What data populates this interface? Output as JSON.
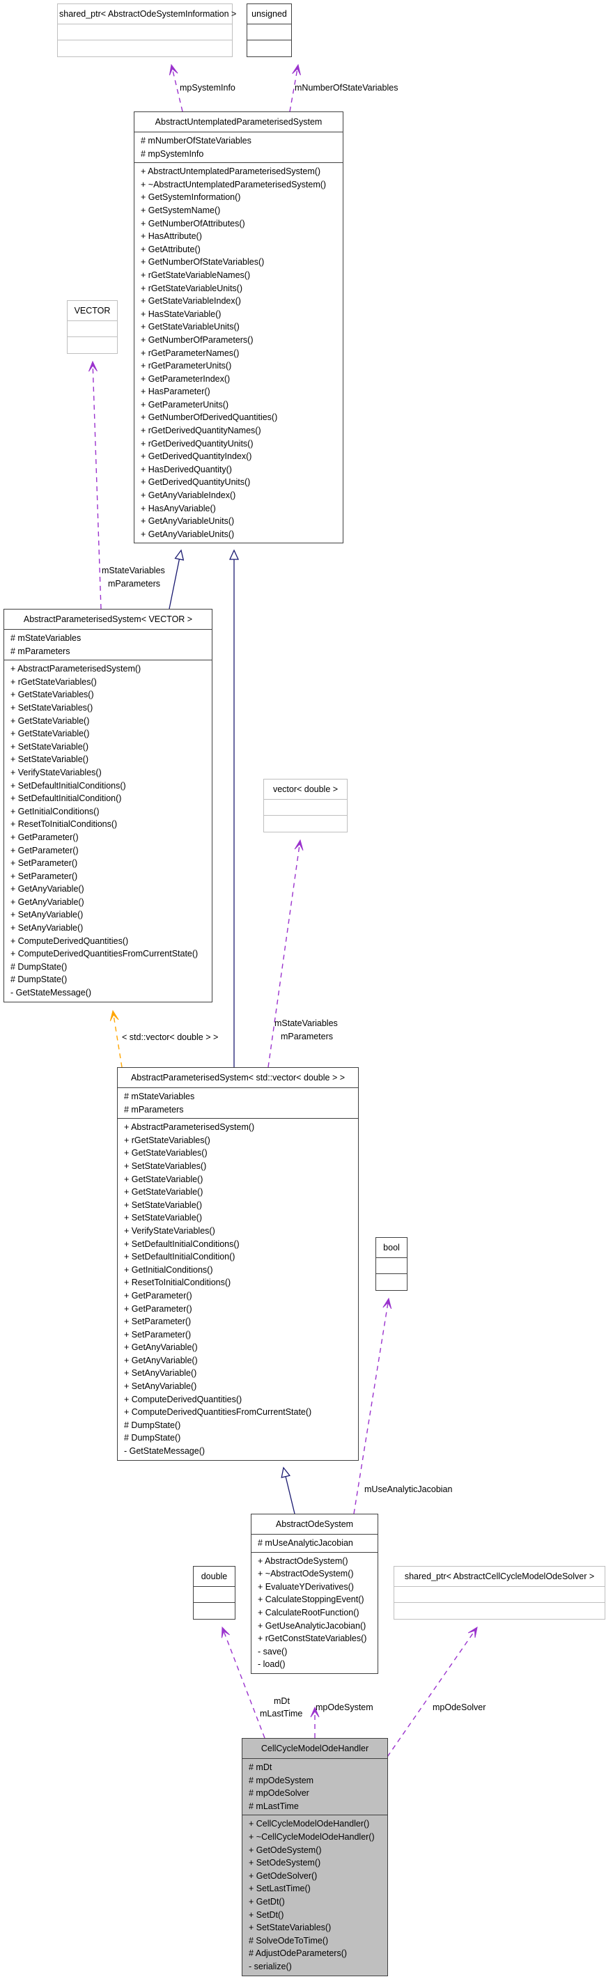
{
  "colors": {
    "usage_edge": "#9a32cd",
    "inherit_edge": "#191970",
    "template_edge": "#ffa500",
    "focus_fill": "#bfbfbf"
  },
  "classes": {
    "shared_ptr_info": {
      "title": "shared_ptr< AbstractOdeSystemInformation >",
      "attributes": [],
      "methods": []
    },
    "unsigned": {
      "title": "unsigned",
      "attributes": [],
      "methods": []
    },
    "untemplated": {
      "title": "AbstractUntemplatedParameterisedSystem",
      "attributes": [
        "# mNumberOfStateVariables",
        "# mpSystemInfo"
      ],
      "methods": [
        "+ AbstractUntemplatedParameterisedSystem()",
        "+ ~AbstractUntemplatedParameterisedSystem()",
        "+ GetSystemInformation()",
        "+ GetSystemName()",
        "+ GetNumberOfAttributes()",
        "+ HasAttribute()",
        "+ GetAttribute()",
        "+ GetNumberOfStateVariables()",
        "+ rGetStateVariableNames()",
        "+ rGetStateVariableUnits()",
        "+ GetStateVariableIndex()",
        "+ HasStateVariable()",
        "+ GetStateVariableUnits()",
        "+ GetNumberOfParameters()",
        "+ rGetParameterNames()",
        "+ rGetParameterUnits()",
        "+ GetParameterIndex()",
        "+ HasParameter()",
        "+ GetParameterUnits()",
        "+ GetNumberOfDerivedQuantities()",
        "+ rGetDerivedQuantityNames()",
        "+ rGetDerivedQuantityUnits()",
        "+ GetDerivedQuantityIndex()",
        "+ HasDerivedQuantity()",
        "+ GetDerivedQuantityUnits()",
        "+ GetAnyVariableIndex()",
        "+ HasAnyVariable()",
        "+ GetAnyVariableUnits()",
        "+ GetAnyVariableUnits()"
      ]
    },
    "vector_tpl": {
      "title": "VECTOR",
      "attributes": [],
      "methods": []
    },
    "param_vector": {
      "title": "AbstractParameterisedSystem< VECTOR >",
      "attributes": [
        "# mStateVariables",
        "# mParameters"
      ],
      "methods": [
        "+ AbstractParameterisedSystem()",
        "+ rGetStateVariables()",
        "+ GetStateVariables()",
        "+ SetStateVariables()",
        "+ GetStateVariable()",
        "+ GetStateVariable()",
        "+ SetStateVariable()",
        "+ SetStateVariable()",
        "+ VerifyStateVariables()",
        "+ SetDefaultInitialConditions()",
        "+ SetDefaultInitialCondition()",
        "+ GetInitialConditions()",
        "+ ResetToInitialConditions()",
        "+ GetParameter()",
        "+ GetParameter()",
        "+ SetParameter()",
        "+ SetParameter()",
        "+ GetAnyVariable()",
        "+ GetAnyVariable()",
        "+ SetAnyVariable()",
        "+ SetAnyVariable()",
        "+ ComputeDerivedQuantities()",
        "+ ComputeDerivedQuantitiesFromCurrentState()",
        "# DumpState()",
        "# DumpState()",
        "- GetStateMessage()"
      ]
    },
    "vector_double": {
      "title": "vector< double >",
      "attributes": [],
      "methods": []
    },
    "param_std_vector": {
      "title": "AbstractParameterisedSystem< std::vector< double > >",
      "attributes": [
        "# mStateVariables",
        "# mParameters"
      ],
      "methods": [
        "+ AbstractParameterisedSystem()",
        "+ rGetStateVariables()",
        "+ GetStateVariables()",
        "+ SetStateVariables()",
        "+ GetStateVariable()",
        "+ GetStateVariable()",
        "+ SetStateVariable()",
        "+ SetStateVariable()",
        "+ VerifyStateVariables()",
        "+ SetDefaultInitialConditions()",
        "+ SetDefaultInitialCondition()",
        "+ GetInitialConditions()",
        "+ ResetToInitialConditions()",
        "+ GetParameter()",
        "+ GetParameter()",
        "+ SetParameter()",
        "+ SetParameter()",
        "+ GetAnyVariable()",
        "+ GetAnyVariable()",
        "+ SetAnyVariable()",
        "+ SetAnyVariable()",
        "+ ComputeDerivedQuantities()",
        "+ ComputeDerivedQuantitiesFromCurrentState()",
        "# DumpState()",
        "# DumpState()",
        "- GetStateMessage()"
      ]
    },
    "bool": {
      "title": "bool",
      "attributes": [],
      "methods": []
    },
    "ode_system": {
      "title": "AbstractOdeSystem",
      "attributes": [
        "# mUseAnalyticJacobian"
      ],
      "methods": [
        "+ AbstractOdeSystem()",
        "+ ~AbstractOdeSystem()",
        "+ EvaluateYDerivatives()",
        "+ CalculateStoppingEvent()",
        "+ CalculateRootFunction()",
        "+ GetUseAnalyticJacobian()",
        "+ rGetConstStateVariables()",
        "- save()",
        "- load()"
      ]
    },
    "double": {
      "title": "double",
      "attributes": [],
      "methods": []
    },
    "shared_ptr_solver": {
      "title": "shared_ptr< AbstractCellCycleModelOdeSolver >",
      "attributes": [],
      "methods": []
    },
    "ode_handler": {
      "title": "CellCycleModelOdeHandler",
      "attributes": [
        "# mDt",
        "# mpOdeSystem",
        "# mpOdeSolver",
        "# mLastTime"
      ],
      "methods": [
        "+ CellCycleModelOdeHandler()",
        "+ ~CellCycleModelOdeHandler()",
        "+ GetOdeSystem()",
        "+ SetOdeSystem()",
        "+ GetOdeSolver()",
        "+ SetLastTime()",
        "+ GetDt()",
        "+ SetDt()",
        "+ SetStateVariables()",
        "# SolveOdeToTime()",
        "# AdjustOdeParameters()",
        "- serialize()"
      ]
    }
  },
  "edge_labels": {
    "mpSystemInfo": "mpSystemInfo",
    "mNumberOfStateVariables": "mNumberOfStateVariables",
    "vector_members_1": "mStateVariables",
    "vector_members_2": "mParameters",
    "template_binding": "< std::vector< double > >",
    "vd_members_1": "mStateVariables",
    "vd_members_2": "mParameters",
    "mUseAnalyticJacobian": "mUseAnalyticJacobian",
    "double_members_1": "mDt",
    "double_members_2": "mLastTime",
    "mpOdeSystem": "mpOdeSystem",
    "mpOdeSolver": "mpOdeSolver"
  },
  "edges": [
    {
      "from": "untemplated",
      "to": "shared_ptr_info",
      "kind": "usage",
      "label": "mpSystemInfo"
    },
    {
      "from": "untemplated",
      "to": "unsigned",
      "kind": "usage",
      "label": "mNumberOfStateVariables"
    },
    {
      "from": "param_vector",
      "to": "untemplated",
      "kind": "inheritance"
    },
    {
      "from": "param_vector",
      "to": "vector_tpl",
      "kind": "usage",
      "label": "mStateVariables mParameters"
    },
    {
      "from": "param_std_vector",
      "to": "untemplated",
      "kind": "inheritance"
    },
    {
      "from": "param_std_vector",
      "to": "param_vector",
      "kind": "template",
      "label": "< std::vector< double > >"
    },
    {
      "from": "param_std_vector",
      "to": "vector_double",
      "kind": "usage",
      "label": "mStateVariables mParameters"
    },
    {
      "from": "ode_system",
      "to": "param_std_vector",
      "kind": "inheritance"
    },
    {
      "from": "ode_system",
      "to": "bool",
      "kind": "usage",
      "label": "mUseAnalyticJacobian"
    },
    {
      "from": "ode_handler",
      "to": "double",
      "kind": "usage",
      "label": "mDt mLastTime"
    },
    {
      "from": "ode_handler",
      "to": "ode_system",
      "kind": "usage",
      "label": "mpOdeSystem"
    },
    {
      "from": "ode_handler",
      "to": "shared_ptr_solver",
      "kind": "usage",
      "label": "mpOdeSolver"
    }
  ]
}
